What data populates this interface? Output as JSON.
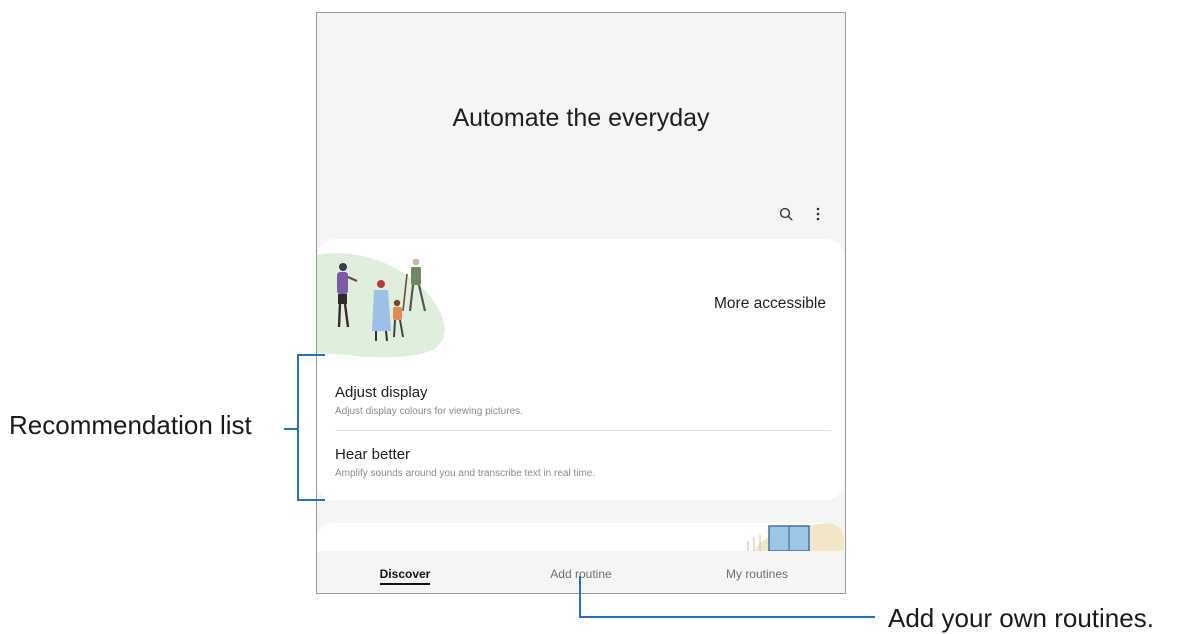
{
  "screen": {
    "title": "Automate the everyday",
    "actions": [
      {
        "icon": "search-icon"
      },
      {
        "icon": "more-options-icon"
      }
    ]
  },
  "card": {
    "header_label": "More accessible",
    "items": [
      {
        "title": "Adjust display",
        "description": "Adjust display colours for viewing pictures."
      },
      {
        "title": "Hear better",
        "description": "Amplify sounds around you and transcribe text in real time."
      }
    ]
  },
  "bottom_nav": {
    "tabs": [
      {
        "label": "Discover",
        "active": true
      },
      {
        "label": "Add routine",
        "active": false
      },
      {
        "label": "My routines",
        "active": false
      }
    ]
  },
  "annotations": {
    "recommendation_list": "Recommendation list",
    "add_own_routines": "Add your own routines."
  },
  "colors": {
    "callout_line": "#2372b9",
    "screen_bg": "#f5f5f5",
    "card_bg": "#ffffff",
    "illustration_bg": "#dfeedd"
  }
}
